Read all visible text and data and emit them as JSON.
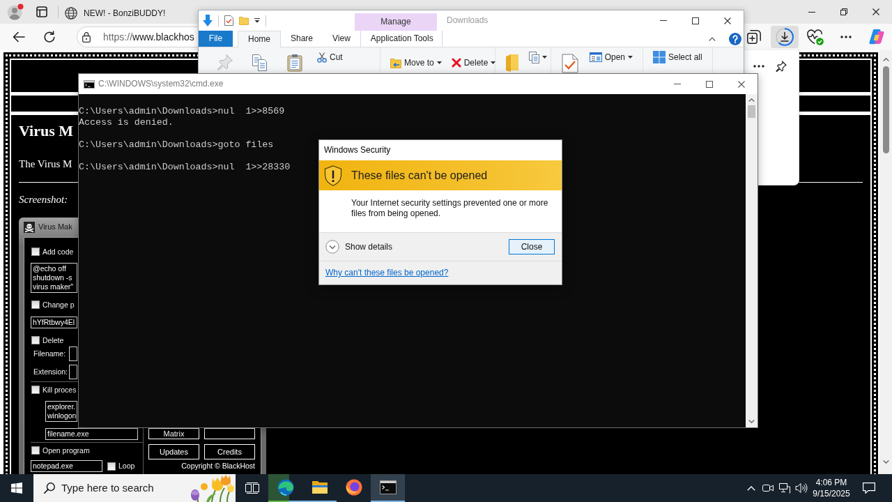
{
  "browser": {
    "tabs": [
      {
        "title": "NEW! - BonziBUDDY!",
        "selected": false
      }
    ],
    "address": {
      "scheme": "https://",
      "rest": "www.blackhos"
    },
    "toolbar": [
      {
        "kind": "collections",
        "active": false
      },
      {
        "kind": "downloads",
        "active": true
      },
      {
        "kind": "health",
        "active": false
      },
      {
        "kind": "more",
        "active": false
      },
      {
        "kind": "copilot",
        "active": false
      }
    ]
  },
  "site": {
    "heading": "Virus M",
    "intro": "The Virus M",
    "screenshot_label": "Screenshot:",
    "app": {
      "title": "Virus Mak",
      "options": [
        {
          "kind": "checkbox",
          "label": "Add code",
          "checked": false
        },
        {
          "kind": "textarea",
          "lines": [
            "@echo off",
            "shutdown -s",
            "virus maker\""
          ]
        },
        {
          "kind": "checkbox",
          "label": "Change p",
          "checked": false
        },
        {
          "kind": "field",
          "value": "hYfRtbwy4El"
        },
        {
          "kind": "checkbox",
          "label": "Delete",
          "checked": false
        },
        {
          "kind": "labeled_field",
          "label": "Filename:"
        },
        {
          "kind": "labeled_field",
          "label": "Extension:"
        },
        {
          "kind": "separator"
        },
        {
          "kind": "checkbox",
          "label": "Kill proces",
          "checked": false,
          "children": [
            {
              "kind": "textarea",
              "lines": [
                "explorer.",
                "winlogon"
              ]
            },
            {
              "kind": "field",
              "value": "filename.exe"
            }
          ]
        },
        {
          "kind": "separator"
        },
        {
          "kind": "checkbox",
          "label": "Open program",
          "checked": false
        },
        {
          "kind": "field_with_checkbox",
          "value": "notepad.exe",
          "checkbox": {
            "label": "Loop",
            "checked": false
          }
        }
      ],
      "buttons": [
        {
          "kind": "labeled",
          "label": "Matrix"
        },
        {
          "kind": "blank"
        },
        {
          "kind": "labeled",
          "label": "Updates"
        },
        {
          "kind": "labeled",
          "label": "Credits"
        }
      ],
      "copyright": "Copyright © BlackHost"
    }
  },
  "explorer": {
    "title": "Downloads",
    "context_header": "Manage",
    "tabs": [
      {
        "label": "File",
        "kind": "file",
        "selected": false
      },
      {
        "label": "Home",
        "kind": "tab",
        "selected": true
      },
      {
        "label": "Share",
        "kind": "tab",
        "selected": false
      },
      {
        "label": "View",
        "kind": "tab",
        "selected": false
      },
      {
        "label": "Application Tools",
        "kind": "context",
        "selected": false
      }
    ],
    "ribbon": [
      [
        {
          "kind": "pin",
          "disabled": true
        },
        {
          "kind": "copy",
          "disabled": false
        },
        {
          "kind": "paste",
          "disabled": false
        },
        {
          "kind": "cut",
          "label": "Cut",
          "disabled": false,
          "dropdown": false
        }
      ],
      [
        {
          "kind": "moveto",
          "label": "Move to",
          "disabled": false,
          "dropdown": true
        },
        {
          "kind": "delete",
          "label": "Delete",
          "disabled": false,
          "dropdown": true
        }
      ],
      [
        {
          "kind": "newfolder",
          "disabled": false
        },
        {
          "kind": "copyto",
          "disabled": false,
          "dropdown": true
        }
      ],
      [
        {
          "kind": "properties",
          "disabled": false
        },
        {
          "kind": "open",
          "label": "Open",
          "disabled": false,
          "dropdown": true
        }
      ],
      [
        {
          "kind": "selectall",
          "label": "Select all",
          "disabled": false,
          "dropdown": false
        }
      ]
    ]
  },
  "cmd": {
    "title": "C:\\WINDOWS\\system32\\cmd.exe",
    "blocks": [
      [
        "C:\\Users\\admin\\Downloads>nul  1>>8569",
        "Access is denied."
      ],
      [
        "C:\\Users\\admin\\Downloads>goto files"
      ],
      [
        "C:\\Users\\admin\\Downloads>nul  1>>28330"
      ]
    ]
  },
  "dialog": {
    "title": "Windows Security",
    "heading": "These files can't be opened",
    "message": "Your Internet security settings prevented one or more files from being opened.",
    "details": {
      "label": "Show details",
      "expanded": false
    },
    "button": "Close",
    "link": "Why can't these files be opened?"
  },
  "taskbar": {
    "search_placeholder": "Type here to search",
    "apps": [
      {
        "kind": "edge",
        "running": true,
        "active": false,
        "level": 0.62
      },
      {
        "kind": "explorer",
        "running": true,
        "active": false
      },
      {
        "kind": "firefox",
        "running": false,
        "active": false
      },
      {
        "kind": "terminal",
        "running": true,
        "active": true
      }
    ],
    "time": "4:06 PM",
    "date": "9/15/2025"
  }
}
